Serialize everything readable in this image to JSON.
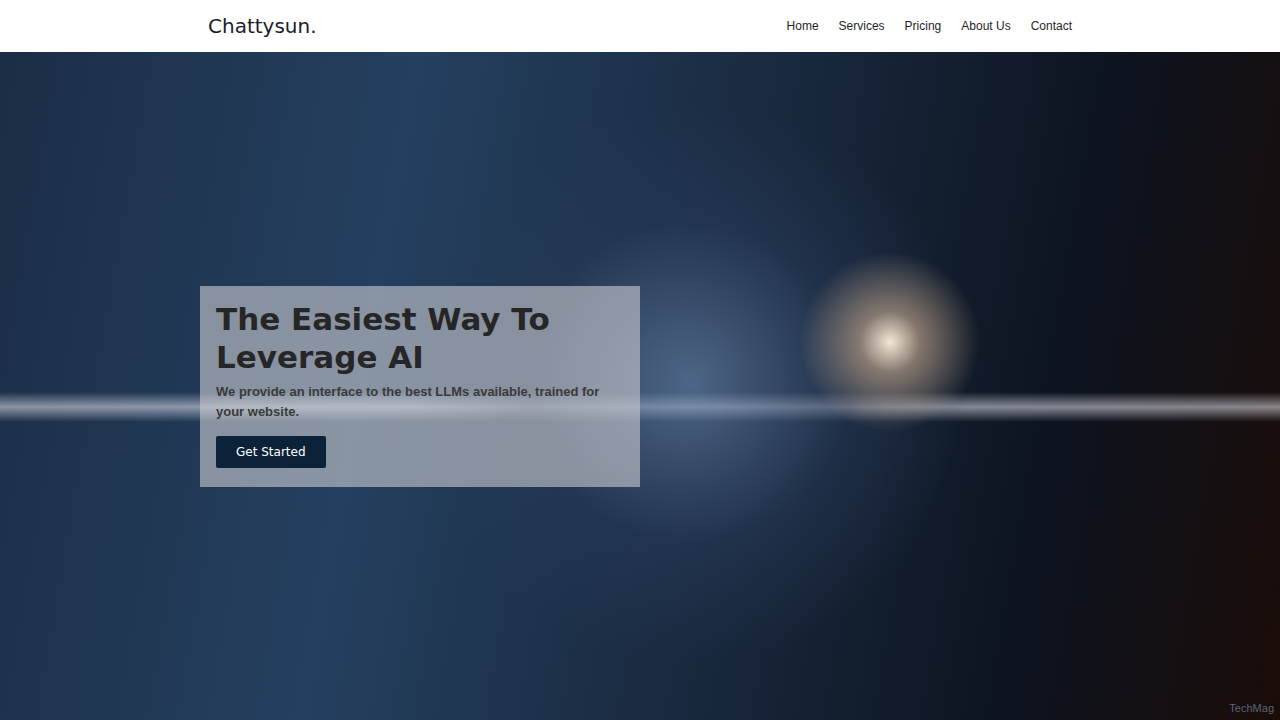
{
  "header": {
    "logo": "Chattysun.",
    "nav": [
      {
        "label": "Home"
      },
      {
        "label": "Services"
      },
      {
        "label": "Pricing"
      },
      {
        "label": "About Us"
      },
      {
        "label": "Contact"
      }
    ]
  },
  "hero": {
    "title": "The Easiest Way To Leverage AI",
    "subtitle": "We provide an interface to the best LLMs available, trained for your website.",
    "button": "Get Started"
  },
  "watermark": "TechMag"
}
